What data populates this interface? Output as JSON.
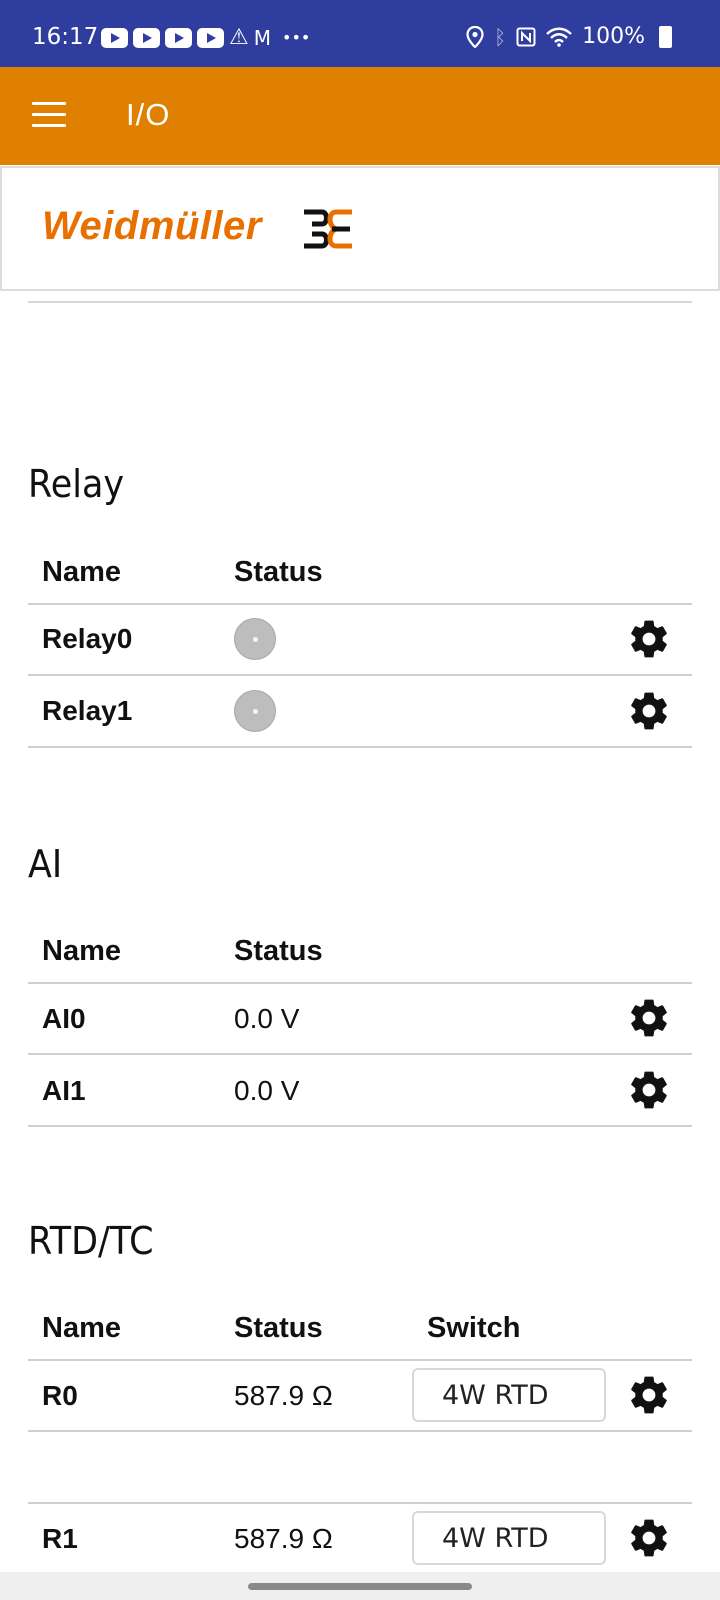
{
  "status_bar": {
    "time": "16:17",
    "battery": "100%",
    "left_icons": [
      "youtube-icon",
      "youtube-icon",
      "youtube-icon",
      "youtube-icon",
      "warning-icon",
      "gmail-icon",
      "more-icon"
    ],
    "right_icons": [
      "location-icon",
      "bluetooth-icon",
      "nfc-icon",
      "wifi-icon",
      "battery-icon"
    ]
  },
  "app_bar": {
    "title": "I/O",
    "color": "#e08000"
  },
  "logo": {
    "text": "Weidmüller",
    "color": "#e87000"
  },
  "relay": {
    "title": "Relay",
    "headers": {
      "name": "Name",
      "status": "Status"
    },
    "rows": [
      {
        "name": "Relay0",
        "status": "off"
      },
      {
        "name": "Relay1",
        "status": "off"
      }
    ]
  },
  "ai": {
    "title": "AI",
    "headers": {
      "name": "Name",
      "status": "Status"
    },
    "rows": [
      {
        "name": "AI0",
        "status": "0.0 V"
      },
      {
        "name": "AI1",
        "status": "0.0 V"
      }
    ]
  },
  "rtd": {
    "title": "RTD/TC",
    "headers": {
      "name": "Name",
      "status": "Status",
      "switch": "Switch"
    },
    "rows": [
      {
        "name": "R0",
        "status": "587.9 Ω",
        "switch": "4W RTD"
      },
      {
        "name": "R1",
        "status": "587.9 Ω",
        "switch": "4W RTD"
      }
    ]
  },
  "colors": {
    "status_bar": "#2f3e9e",
    "accent": "#e08000"
  }
}
